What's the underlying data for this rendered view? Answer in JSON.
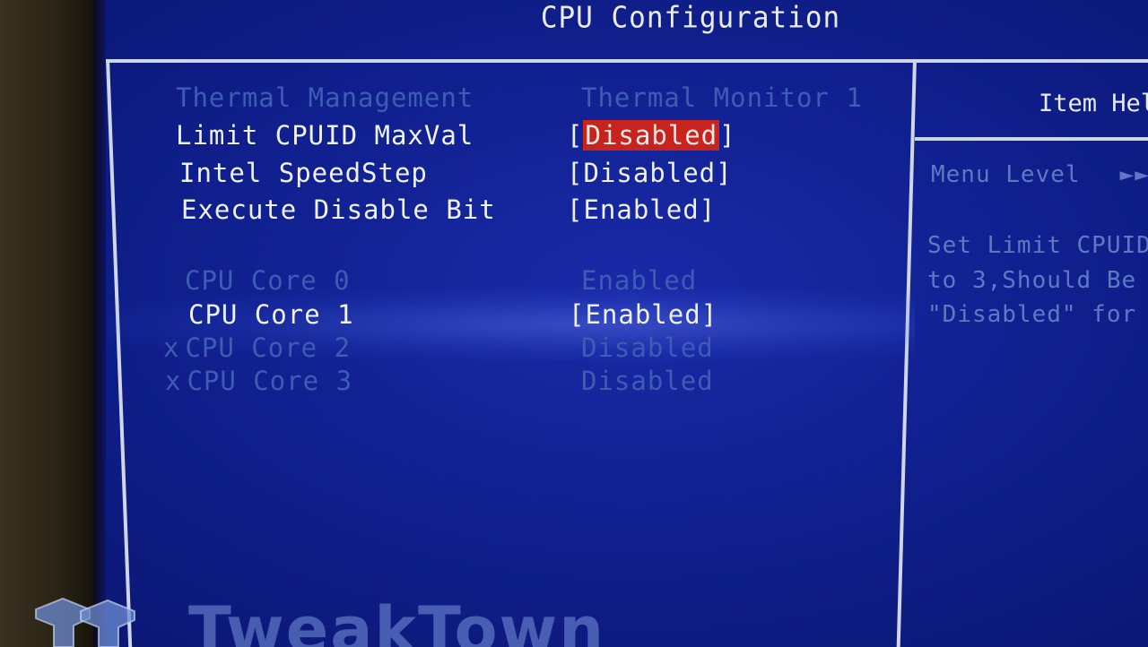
{
  "header": {
    "title": "CPU Configuration"
  },
  "items": [
    {
      "label": "Thermal Management",
      "value": "Thermal Monitor 1",
      "state": "disabled"
    },
    {
      "label": "Limit CPUID MaxVal",
      "value": "Disabled",
      "state": "selected"
    },
    {
      "label": "Intel SpeedStep",
      "value": "Disabled",
      "state": "active"
    },
    {
      "label": "Execute Disable Bit",
      "value": "Enabled",
      "state": "active"
    },
    {
      "label": "CPU Core 0",
      "value": "Enabled",
      "state": "disabled"
    },
    {
      "label": "CPU Core 1",
      "value": "Enabled",
      "state": "active"
    },
    {
      "label": "CPU Core 2",
      "value": "Disabled",
      "state": "disabled",
      "marker": "x"
    },
    {
      "label": "CPU Core 3",
      "value": "Disabled",
      "state": "disabled",
      "marker": "x"
    }
  ],
  "help": {
    "title": "Item Hel",
    "menu_level_label": "Menu Level",
    "menu_level_value": "►►",
    "lines": [
      "Set Limit CPUID",
      "to 3,Should Be",
      "\"Disabled\" for Wi"
    ]
  },
  "watermark": {
    "text": "TweakTown"
  },
  "colors": {
    "background": "#10208f",
    "text": "#eef1f8",
    "dimmed_text": "#3e5cb4",
    "highlight": "#c8241e"
  }
}
